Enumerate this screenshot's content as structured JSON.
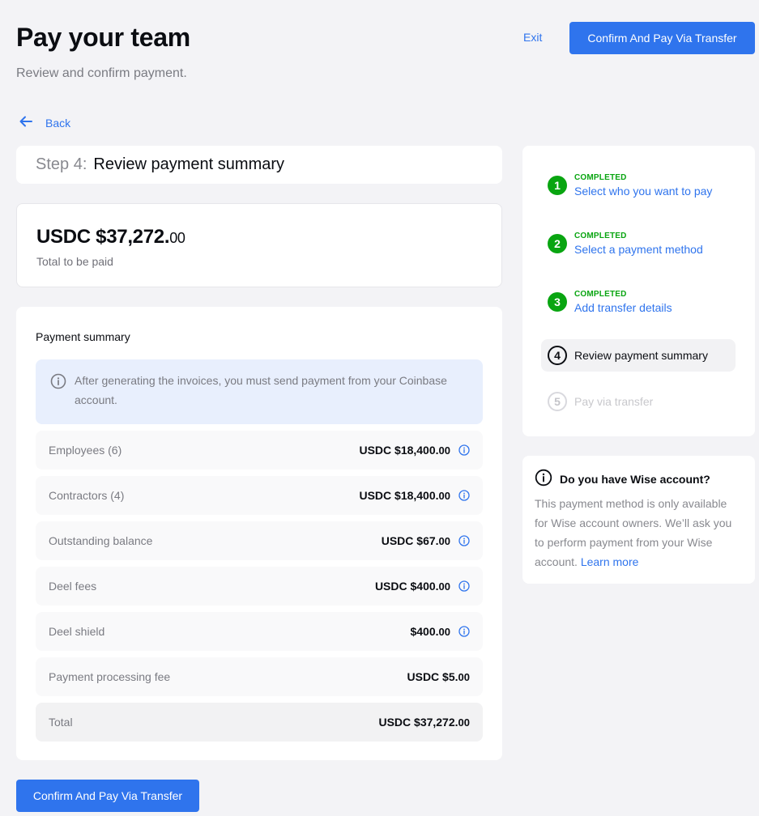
{
  "header": {
    "title": "Pay your team",
    "subtitle": "Review and confirm payment.",
    "exit_label": "Exit",
    "confirm_label": "Confirm And Pay Via Transfer"
  },
  "nav": {
    "back_label": "Back"
  },
  "step_header": {
    "step_number": "Step 4:",
    "step_title": "Review payment summary"
  },
  "total": {
    "amount_main": "USDC $37,272.",
    "amount_cents": "00",
    "label": "Total to be paid"
  },
  "summary": {
    "title": "Payment summary",
    "alert_text": "After generating the invoices, you must send payment from your Coinbase account.",
    "rows": [
      {
        "label": "Employees (6)",
        "value_main": "USDC $18,400.",
        "value_cents": "00",
        "info": true
      },
      {
        "label": "Contractors (4)",
        "value_main": "USDC $18,400.",
        "value_cents": "00",
        "info": true
      },
      {
        "label": "Outstanding balance",
        "value_main": "USDC $67.",
        "value_cents": "00",
        "info": true
      },
      {
        "label": "Deel fees",
        "value_main": "USDC $400.",
        "value_cents": "00",
        "info": true
      },
      {
        "label": "Deel shield",
        "value_main": "$400.",
        "value_cents": "00",
        "info": true
      },
      {
        "label": "Payment processing fee",
        "value_main": "USDC $5.",
        "value_cents": "00",
        "info": false
      },
      {
        "label": "Total",
        "value_main": "USDC $37,272.",
        "value_cents": "00",
        "info": false
      }
    ]
  },
  "stepper": {
    "steps": [
      {
        "number": "1",
        "status": "COMPLETED",
        "label": "Select who you want to pay",
        "state": "completed"
      },
      {
        "number": "2",
        "status": "COMPLETED",
        "label": "Select a payment method",
        "state": "completed"
      },
      {
        "number": "3",
        "status": "COMPLETED",
        "label": "Add transfer details",
        "state": "completed"
      },
      {
        "number": "4",
        "status": "",
        "label": "Review payment summary",
        "state": "current"
      },
      {
        "number": "5",
        "status": "",
        "label": "Pay via transfer",
        "state": "upcoming"
      }
    ]
  },
  "wise": {
    "title": "Do you have Wise account?",
    "body": "This payment method is only available for Wise account owners. We’ll ask you to perform payment from your Wise account.",
    "link_label": "Learn more"
  },
  "footer": {
    "confirm_label": "Confirm And Pay Via Transfer"
  },
  "colors": {
    "primary": "#2f74ed",
    "success": "#09a511",
    "background": "#f3f3f6",
    "alert_bg": "#e8effd"
  }
}
